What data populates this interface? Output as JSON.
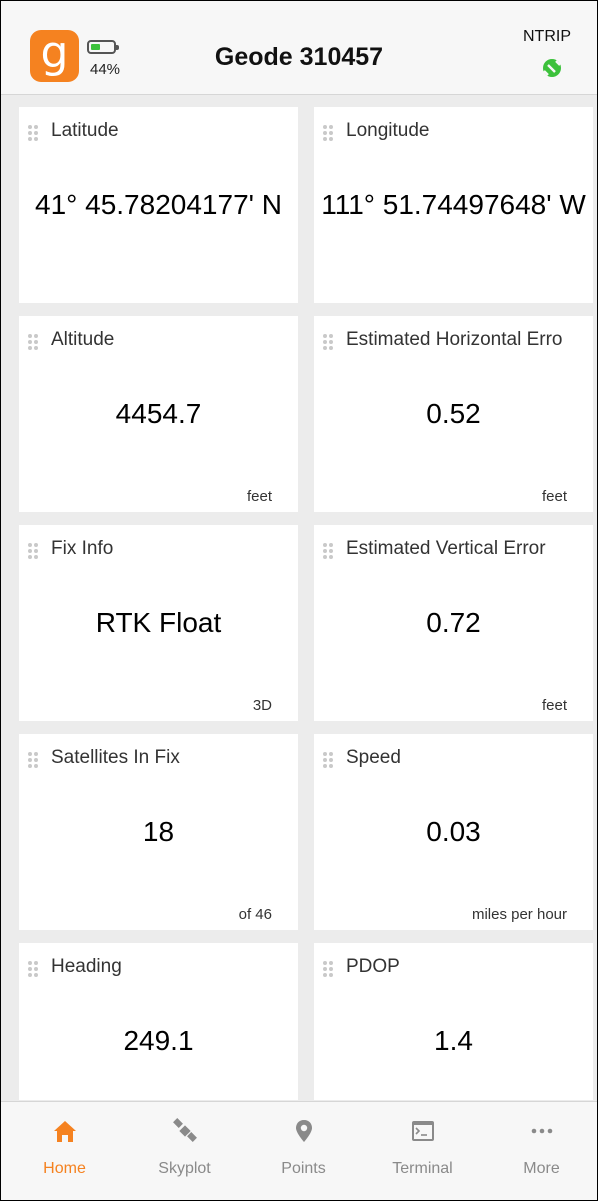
{
  "header": {
    "battery_pct": "44%",
    "battery_level": 0.44,
    "title": "Geode 310457",
    "ntrip_label": "NTRIP",
    "ntrip_status_color": "#3cc13b",
    "logo_letter": "g",
    "logo_color": "#f58220"
  },
  "cards": [
    {
      "label": "Latitude",
      "value": "41° 45.78204177' N",
      "unit": ""
    },
    {
      "label": "Longitude",
      "value": "111° 51.74497648' W",
      "unit": ""
    },
    {
      "label": "Altitude",
      "value": "4454.7",
      "unit": "feet"
    },
    {
      "label": "Estimated Horizontal Erro",
      "value": "0.52",
      "unit": "feet"
    },
    {
      "label": "Fix Info",
      "value": "RTK Float",
      "unit": "3D"
    },
    {
      "label": "Estimated Vertical Error",
      "value": "0.72",
      "unit": "feet"
    },
    {
      "label": "Satellites In Fix",
      "value": "18",
      "unit": "of 46"
    },
    {
      "label": "Speed",
      "value": "0.03",
      "unit": "miles per hour"
    },
    {
      "label": "Heading",
      "value": "249.1",
      "unit": ""
    },
    {
      "label": "PDOP",
      "value": "1.4",
      "unit": ""
    }
  ],
  "tabs": [
    {
      "label": "Home",
      "icon": "home-icon",
      "active": true
    },
    {
      "label": "Skyplot",
      "icon": "satellite-icon",
      "active": false
    },
    {
      "label": "Points",
      "icon": "map-pin-icon",
      "active": false
    },
    {
      "label": "Terminal",
      "icon": "terminal-icon",
      "active": false
    },
    {
      "label": "More",
      "icon": "more-dots-icon",
      "active": false
    }
  ],
  "colors": {
    "accent": "#f58220",
    "inactive": "#8a8a8a"
  }
}
